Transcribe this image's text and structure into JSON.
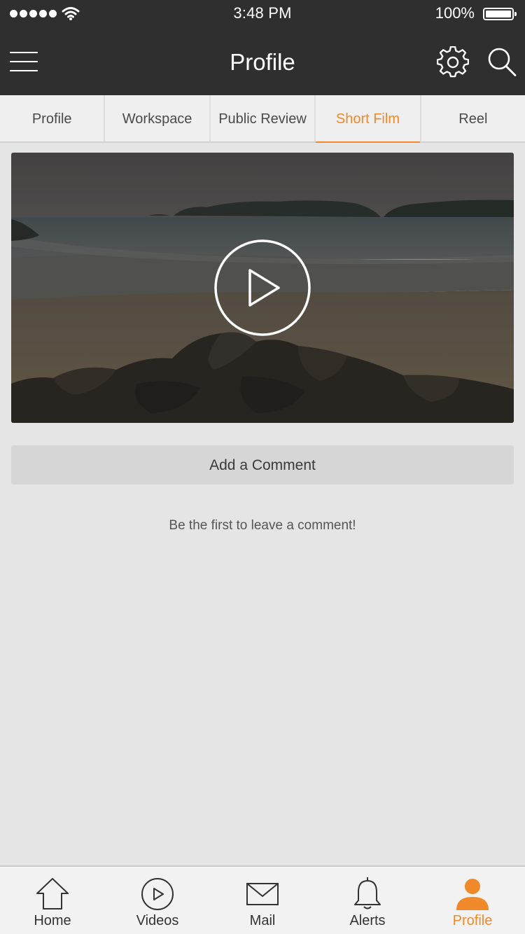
{
  "status_bar": {
    "time": "3:48 PM",
    "battery": "100%",
    "signal_icon": "signal-dots-icon",
    "wifi_icon": "wifi-icon",
    "battery_icon": "battery-icon"
  },
  "header": {
    "title": "Profile",
    "menu_icon": "hamburger-menu-icon",
    "settings_icon": "gear-icon",
    "search_icon": "search-icon"
  },
  "tabs": [
    {
      "label": "Profile",
      "active": false
    },
    {
      "label": "Workspace",
      "active": false
    },
    {
      "label": "Public Review",
      "active": false
    },
    {
      "label": "Short Film",
      "active": true
    },
    {
      "label": "Reel",
      "active": false
    }
  ],
  "video": {
    "play_icon": "play-circle-icon"
  },
  "comments": {
    "add_label": "Add a Comment",
    "empty_message": "Be the first to leave a comment!"
  },
  "bottom_nav": [
    {
      "label": "Home",
      "icon": "home-icon",
      "active": false
    },
    {
      "label": "Videos",
      "icon": "video-play-icon",
      "active": false
    },
    {
      "label": "Mail",
      "icon": "mail-icon",
      "active": false
    },
    {
      "label": "Alerts",
      "icon": "bell-icon",
      "active": false
    },
    {
      "label": "Profile",
      "icon": "person-icon",
      "active": true
    }
  ],
  "colors": {
    "accent": "#f0892a",
    "header_bg": "#2f2f2f",
    "page_bg": "#e5e5e5"
  }
}
